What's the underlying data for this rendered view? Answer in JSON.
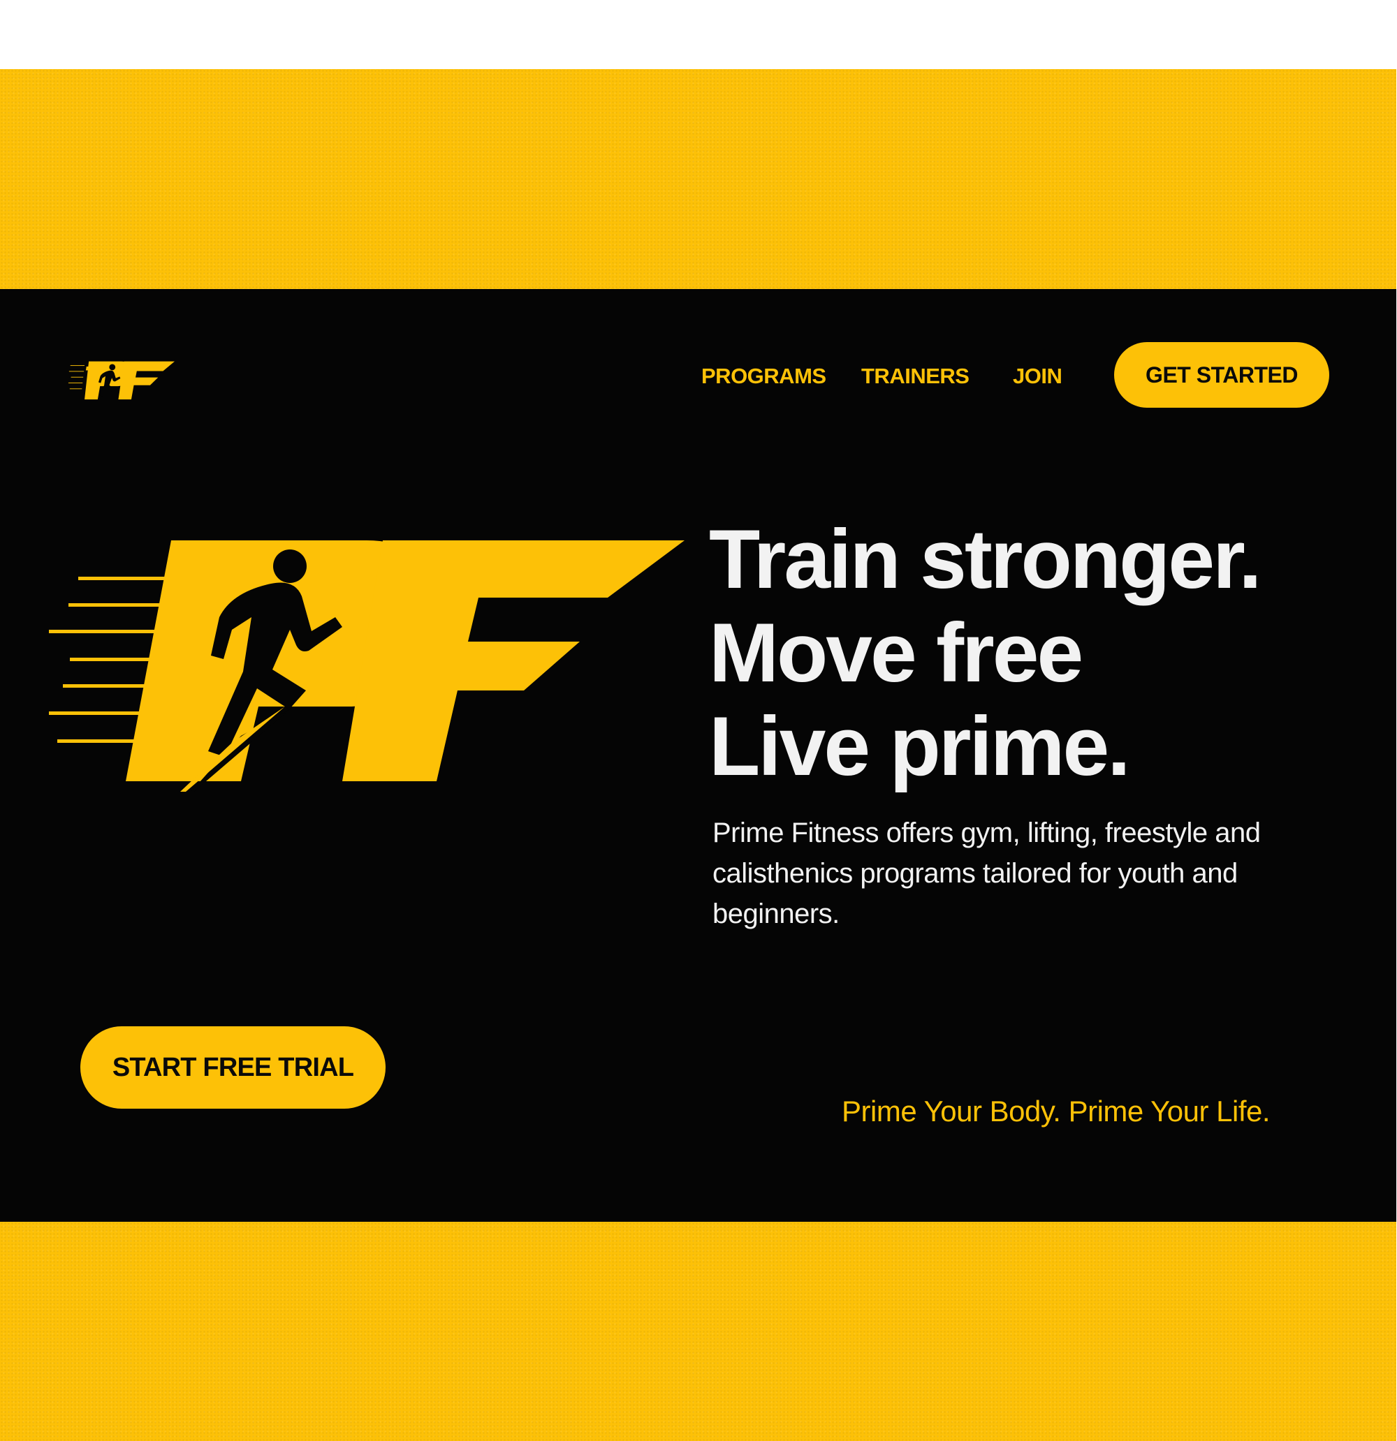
{
  "nav": {
    "logo_text": "PF",
    "links": [
      {
        "label": "PROGRAMS"
      },
      {
        "label": "TRAINERS"
      },
      {
        "label": "JOIN"
      }
    ],
    "cta_label": "GET STARTED"
  },
  "hero": {
    "logo_text": "PF",
    "headline_lines": [
      "Train stronger.",
      "Move free",
      "Live prime."
    ],
    "description": "Prime Fitness offers gym, lifting, freestyle and calisthenics programs tailored for youth and beginners.",
    "trial_label": "START FREE TRIAL",
    "tagline": "Prime Your Body. Prime Your Life."
  },
  "colors": {
    "brand_yellow": "#FDC107",
    "hero_background": "#050505",
    "headline_text": "#F2F2F2",
    "button_text": "#0A0A0A"
  },
  "icons": {
    "nav_logo": "runner-pf-logo-icon",
    "hero_logo": "runner-pf-logo-icon",
    "runner": "running-man-icon"
  }
}
